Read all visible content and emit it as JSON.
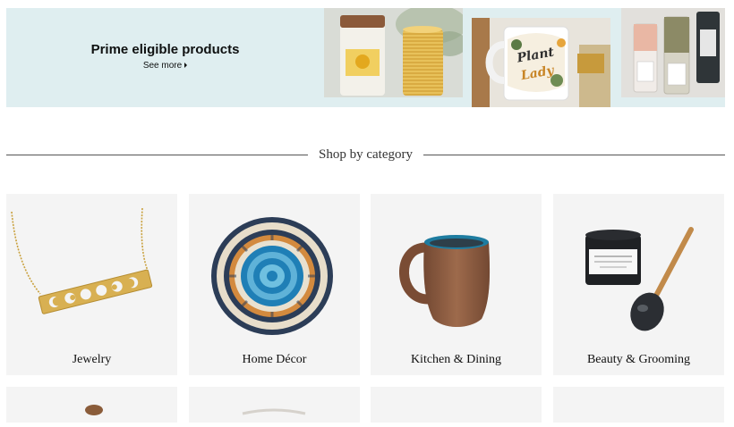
{
  "banner": {
    "title": "Prime eligible products",
    "see_more": "See more",
    "thumbnails": [
      {
        "icon": "candles-image"
      },
      {
        "icon": "plant-lady-mug-image",
        "mug_text_1": "Plant",
        "mug_text_2": "Lady"
      },
      {
        "icon": "bath-salts-bottles-image"
      }
    ]
  },
  "section": {
    "heading": "Shop by category"
  },
  "categories": [
    {
      "label": "Jewelry",
      "icon": "moon-phase-necklace-image"
    },
    {
      "label": "Home Décor",
      "icon": "woven-basket-image"
    },
    {
      "label": "Kitchen & Dining",
      "icon": "ceramic-mug-image"
    },
    {
      "label": "Beauty & Grooming",
      "icon": "charcoal-mask-jar-image"
    }
  ],
  "colors": {
    "banner_bg": "#dfeef0",
    "tile_bg": "#f4f4f4",
    "text": "#0f1111"
  }
}
